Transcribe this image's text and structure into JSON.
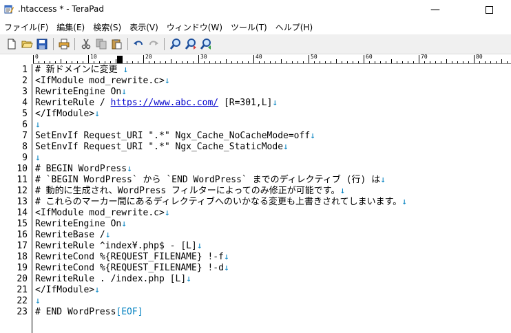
{
  "window": {
    "title": ".htaccess * - TeraPad",
    "minimize_glyph": "—"
  },
  "menu": [
    {
      "label": "ファイル(F)"
    },
    {
      "label": "編集(E)"
    },
    {
      "label": "検索(S)"
    },
    {
      "label": "表示(V)"
    },
    {
      "label": "ウィンドウ(W)"
    },
    {
      "label": "ツール(T)"
    },
    {
      "label": "ヘルプ(H)"
    }
  ],
  "toolbar": {
    "icons": [
      "new-file-icon",
      "open-folder-icon",
      "save-icon",
      "print-icon",
      "cut-icon",
      "copy-icon",
      "paste-icon",
      "undo-icon",
      "redo-icon",
      "find-icon",
      "find-next-icon",
      "find-prev-icon"
    ]
  },
  "ruler": {
    "labels": [
      "0",
      "10",
      "20",
      "30",
      "40",
      "50",
      "60",
      "70",
      "80"
    ]
  },
  "editor": {
    "newline_marker": "↓",
    "eof_marker": "[EOF]",
    "lines": [
      {
        "no": "1",
        "text": "# 新ドメインに変更 "
      },
      {
        "no": "2",
        "text": "<IfModule mod_rewrite.c>"
      },
      {
        "no": "3",
        "text": "RewriteEngine On"
      },
      {
        "no": "4",
        "text": "RewriteRule / ",
        "link": "https://www.abc.com/",
        "after": " [R=301,L]"
      },
      {
        "no": "5",
        "text": "</IfModule>"
      },
      {
        "no": "6",
        "text": ""
      },
      {
        "no": "7",
        "text": "SetEnvIf Request_URI \".*\" Ngx_Cache_NoCacheMode=off"
      },
      {
        "no": "8",
        "text": "SetEnvIf Request_URI \".*\" Ngx_Cache_StaticMode"
      },
      {
        "no": "9",
        "text": ""
      },
      {
        "no": "10",
        "text": "# BEGIN WordPress"
      },
      {
        "no": "11",
        "text": "# `BEGIN WordPress` から `END WordPress` までのディレクティブ (行) は"
      },
      {
        "no": "12",
        "text": "# 動的に生成され、WordPress フィルターによってのみ修正が可能です。"
      },
      {
        "no": "13",
        "text": "# これらのマーカー間にあるディレクティブへのいかなる変更も上書きされてしまいます。"
      },
      {
        "no": "14",
        "text": "<IfModule mod_rewrite.c>"
      },
      {
        "no": "15",
        "text": "RewriteEngine On"
      },
      {
        "no": "16",
        "text": "RewriteBase /"
      },
      {
        "no": "17",
        "text": "RewriteRule ^index¥.php$ - [L]"
      },
      {
        "no": "18",
        "text": "RewriteCond %{REQUEST_FILENAME} !-f"
      },
      {
        "no": "19",
        "text": "RewriteCond %{REQUEST_FILENAME} !-d"
      },
      {
        "no": "20",
        "text": "RewriteRule . /index.php [L]"
      },
      {
        "no": "21",
        "text": "</IfModule>"
      },
      {
        "no": "22",
        "text": ""
      },
      {
        "no": "23",
        "text": "# END WordPress",
        "eof": true
      }
    ]
  }
}
